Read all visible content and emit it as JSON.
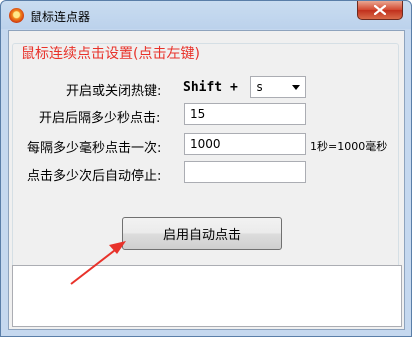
{
  "window": {
    "title": "鼠标连点器"
  },
  "group": {
    "title": "鼠标连续点击设置(点击左键)"
  },
  "hotkey": {
    "label": "开启或关闭热键:",
    "modifier": "Shift +",
    "key": "s"
  },
  "start_interval": {
    "label": "开启后隔多少秒点击:",
    "value": "15"
  },
  "click_interval": {
    "label": "每隔多少毫秒点击一次:",
    "value": "1000",
    "unit": "1秒=1000毫秒"
  },
  "auto_stop": {
    "label": "点击多少次后自动停止:",
    "value": ""
  },
  "start_button": {
    "label": "启用自动点击"
  },
  "log": {
    "text": ""
  },
  "colors": {
    "legend": "#e8322a",
    "annotation_arrow": "#e8322a"
  }
}
